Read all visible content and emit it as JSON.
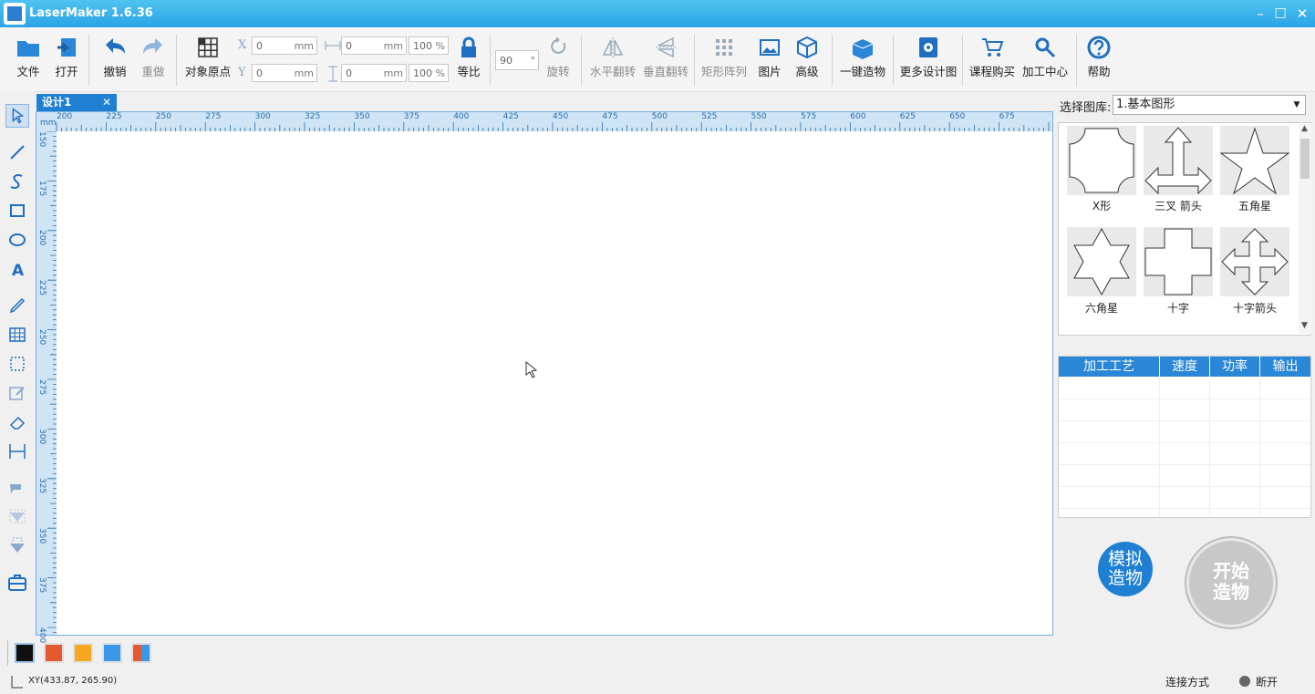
{
  "window": {
    "title": "LaserMaker 1.6.36",
    "minimize": "–",
    "maximize": "☐",
    "close": "✕"
  },
  "toolbar": {
    "file": "文件",
    "open": "打开",
    "undo": "撤销",
    "redo": "重做",
    "origin": "对象原点",
    "x_label": "X",
    "y_label": "Y",
    "x_value": "0",
    "y_value": "0",
    "w_value": "0",
    "h_value": "0",
    "unit": "mm",
    "w_pct": "100",
    "h_pct": "100",
    "pct": "%",
    "lock_ratio": "等比",
    "rotate_value": "90",
    "rotate_unit": "°",
    "rotate": "旋转",
    "hflip": "水平翻转",
    "vflip": "垂直翻转",
    "array": "矩形阵列",
    "image": "图片",
    "advanced": "高级",
    "one_click": "一键造物",
    "more_designs": "更多设计图",
    "buy_course": "课程购买",
    "center": "加工中心",
    "help": "帮助"
  },
  "document": {
    "tab": "设计1",
    "tab_close": "✕"
  },
  "ruler": {
    "unit": "mm",
    "h_ticks": [
      "200",
      "225",
      "250",
      "275",
      "300",
      "325",
      "350",
      "375",
      "400",
      "425",
      "450",
      "475",
      "500",
      "525",
      "550",
      "575",
      "600",
      "625",
      "650",
      "675"
    ],
    "v_ticks": [
      "150",
      "175",
      "200",
      "225",
      "250",
      "275",
      "300",
      "325",
      "350",
      "375",
      "400"
    ]
  },
  "library": {
    "label": "选择图库:",
    "selected": "1.基本图形",
    "shapes": [
      {
        "label": "X形",
        "icon": "x-shape-icon"
      },
      {
        "label": "三叉 箭头",
        "icon": "trident-arrow-icon"
      },
      {
        "label": "五角星",
        "icon": "five-point-star-icon"
      },
      {
        "label": "六角星",
        "icon": "six-point-star-icon"
      },
      {
        "label": "十字",
        "icon": "cross-icon"
      },
      {
        "label": "十字箭头",
        "icon": "cross-arrow-icon"
      }
    ]
  },
  "process_table": {
    "headers": [
      "加工工艺",
      "速度",
      "功率",
      "输出"
    ],
    "rows": []
  },
  "actions": {
    "simulate": "模拟\n造物",
    "simulate_l1": "模拟",
    "simulate_l2": "造物",
    "start_l1": "开始",
    "start_l2": "造物"
  },
  "palette": {
    "colors": [
      "#111111",
      "#e25a2d",
      "#f7a823",
      "#3b97e8",
      "multi"
    ]
  },
  "status": {
    "coords": "XY(433.87, 265.90)",
    "connection_label": "连接方式",
    "connection_state": "断开"
  },
  "colors": {
    "accent": "#1f7fd2",
    "title_bar": "#2aa3e6"
  }
}
